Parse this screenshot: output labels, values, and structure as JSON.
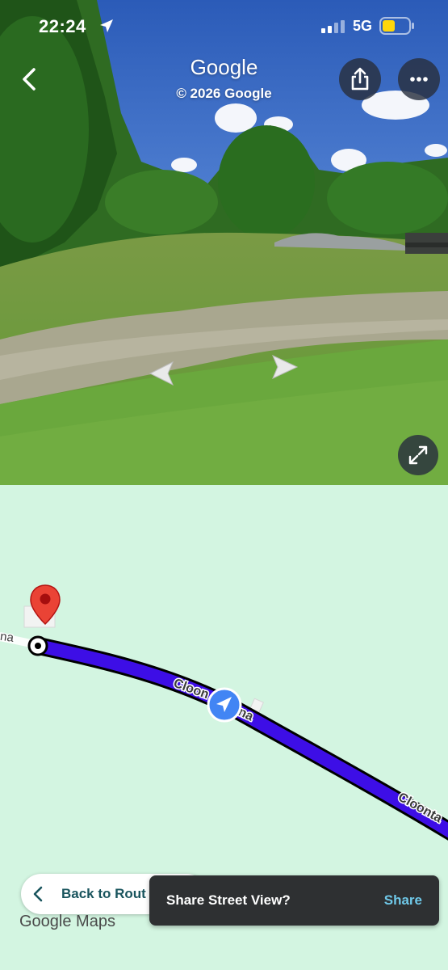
{
  "status_bar": {
    "time": "22:24",
    "network": "5G",
    "icons": [
      "location-arrow-icon",
      "signal-icon",
      "battery-icon"
    ]
  },
  "street_view": {
    "title": "Google",
    "copyright": "© 2026 Google",
    "buttons": [
      "back-chevron-icon",
      "share-icon",
      "more-dots-icon",
      "expand-icon"
    ],
    "nav_arrows": [
      "left-arrow",
      "right-arrow"
    ]
  },
  "map": {
    "road_label_partial_left": "na",
    "road_label_1": "Cloon",
    "road_label_1_tail": "na",
    "road_label_2": "Cloonta",
    "colors": {
      "background": "#d3f5e1",
      "route": "#3d0ee6",
      "pin": "#ea4335",
      "location_button": "#4285f4"
    }
  },
  "back_to_route": {
    "label": "Back to Rout"
  },
  "logo": {
    "text": "Google Maps"
  },
  "toast": {
    "message": "Share Street View?",
    "action": "Share"
  }
}
